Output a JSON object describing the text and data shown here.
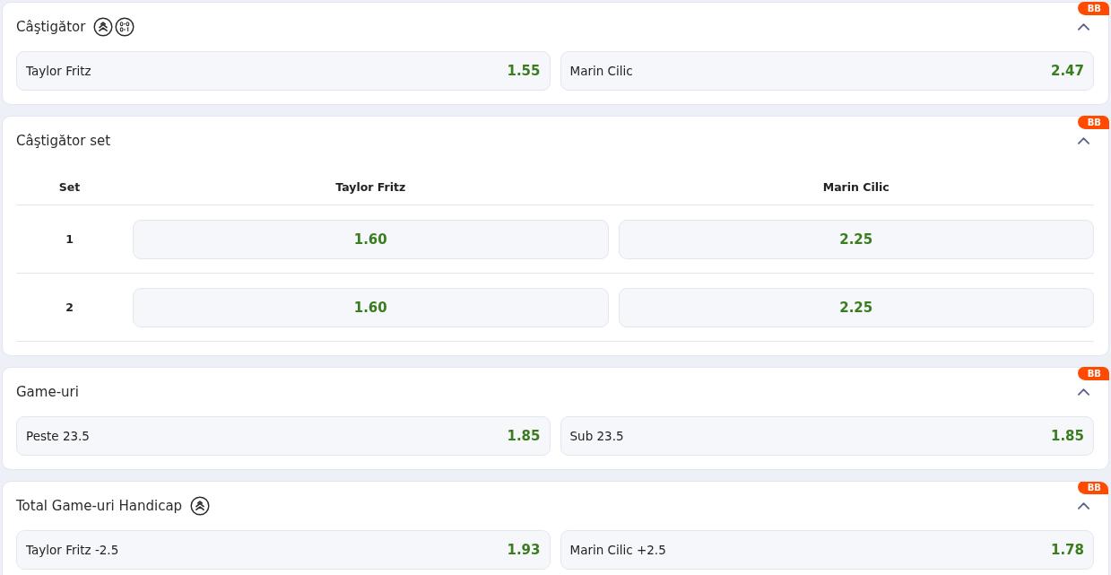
{
  "markets": [
    {
      "kind": "pair",
      "title": "Câştigător",
      "icons": [
        {
          "kind": "boost"
        },
        {
          "kind": "score"
        }
      ],
      "badge": "BB",
      "expanded": true,
      "selections": [
        {
          "label": "Taylor Fritz",
          "odds": "1.55",
          "selected": false
        },
        {
          "label": "Marin Cilic",
          "odds": "2.47",
          "selected": false
        }
      ]
    },
    {
      "kind": "table",
      "title": "Câştigător set",
      "badge": "BB",
      "expanded": true,
      "columns": [
        "Set",
        "Taylor Fritz",
        "Marin Cilic"
      ],
      "rows": [
        {
          "set": "1",
          "selections": [
            {
              "odds": "1.60",
              "selected": false
            },
            {
              "odds": "2.25",
              "selected": false
            }
          ]
        },
        {
          "set": "2",
          "selections": [
            {
              "odds": "1.60",
              "selected": false
            },
            {
              "odds": "2.25",
              "selected": false
            }
          ]
        }
      ]
    },
    {
      "kind": "pair",
      "title": "Game-uri",
      "badge": "BB",
      "expanded": true,
      "selections": [
        {
          "label": "Peste 23.5",
          "odds": "1.85",
          "selected": false
        },
        {
          "label": "Sub 23.5",
          "odds": "1.85",
          "selected": false
        }
      ]
    },
    {
      "kind": "pair",
      "title": "Total Game-uri Handicap",
      "icons": [
        {
          "kind": "boost"
        }
      ],
      "badge": "BB",
      "expanded": true,
      "selections": [
        {
          "label": "Taylor Fritz -2.5",
          "odds": "1.93",
          "selected": false
        },
        {
          "label": "Marin Cilic +2.5",
          "odds": "1.78",
          "selected": false
        }
      ]
    }
  ]
}
